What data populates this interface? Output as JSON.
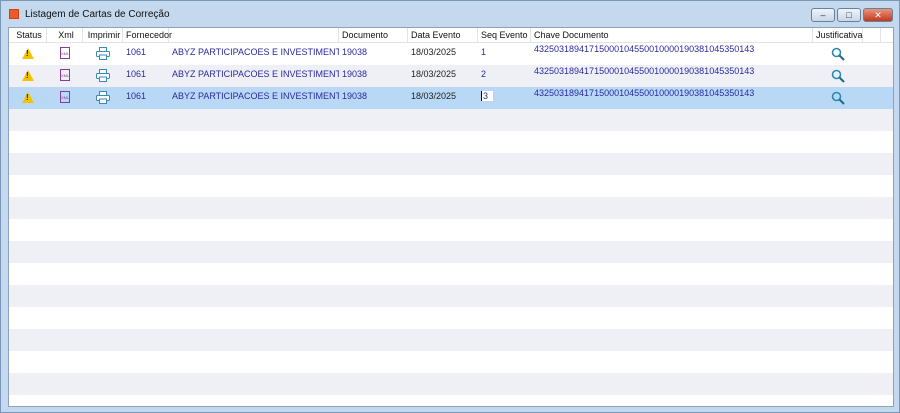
{
  "window": {
    "title": "Listagem de Cartas de Correção",
    "minimize": "–",
    "maximize": "□",
    "close": "✕"
  },
  "columns": [
    "Status",
    "Xml",
    "Imprimir",
    "Fornecedor",
    "",
    "Documento",
    "Data Evento",
    "Seq Evento",
    "Chave Documento",
    "Justificativa"
  ],
  "rows": [
    {
      "status_icon": "warning-icon",
      "fornecedor": "1061",
      "nome": "ABYZ PARTICIPACOES E INVESTIMENTOS L",
      "documento": "19038",
      "data": "18/03/2025",
      "seq": "1",
      "chave": "43250318941715000104550010000190381045350143"
    },
    {
      "status_icon": "warning-icon",
      "fornecedor": "1061",
      "nome": "ABYZ PARTICIPACOES E INVESTIMENTOS L",
      "documento": "19038",
      "data": "18/03/2025",
      "seq": "2",
      "chave": "43250318941715000104550010000190381045350143"
    },
    {
      "status_icon": "warning-icon",
      "fornecedor": "1061",
      "nome": "ABYZ PARTICIPACOES E INVESTIMENTOS L",
      "documento": "19038",
      "data": "18/03/2025",
      "seq": "3",
      "chave": "43250318941715000104550010000190381045350143"
    }
  ],
  "empty_rows": 13,
  "xml_icon_text": "XML"
}
